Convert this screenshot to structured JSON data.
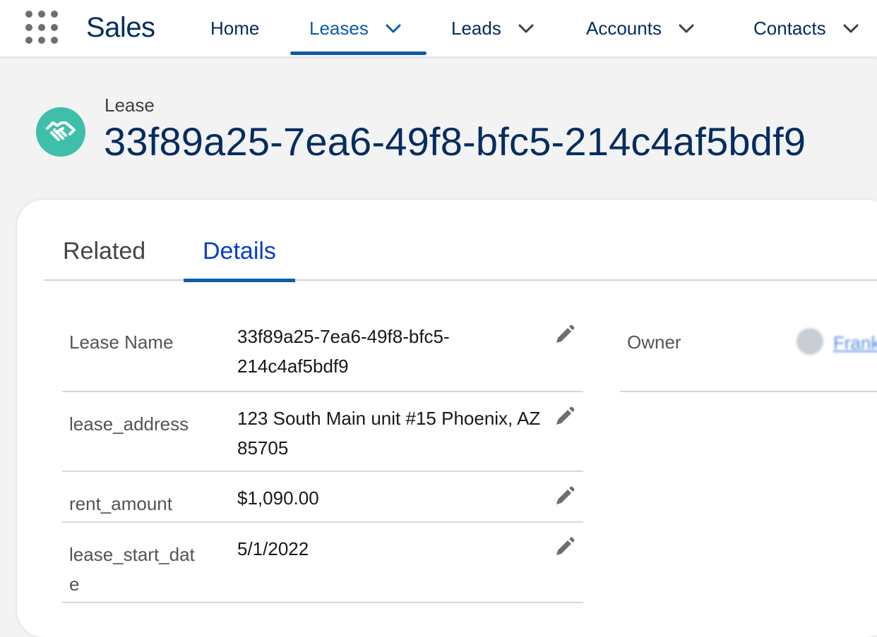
{
  "app": {
    "name": "Sales"
  },
  "nav": {
    "items": [
      {
        "label": "Home",
        "has_menu": false,
        "active": false
      },
      {
        "label": "Leases",
        "has_menu": true,
        "active": true
      },
      {
        "label": "Leads",
        "has_menu": true,
        "active": false
      },
      {
        "label": "Accounts",
        "has_menu": true,
        "active": false
      },
      {
        "label": "Contacts",
        "has_menu": true,
        "active": false
      }
    ]
  },
  "record": {
    "object_label": "Lease",
    "title": "33f89a25-7ea6-49f8-bfc5-214c4af5bdf9",
    "icon": "handshake-icon",
    "icon_color": "#3fbfa9"
  },
  "tabs": [
    {
      "label": "Related",
      "active": false
    },
    {
      "label": "Details",
      "active": true
    }
  ],
  "fields": [
    {
      "label": "Lease Name",
      "value": "33f89a25-7ea6-49f8-bfc5-214c4af5bdf9"
    },
    {
      "label": "lease_address",
      "value": "123 South Main unit #15 Phoenix, AZ 85705"
    },
    {
      "label": "rent_amount",
      "value": "$1,090.00"
    },
    {
      "label": "lease_start_date",
      "value": "5/1/2022"
    }
  ],
  "owner": {
    "label": "Owner",
    "name": "Frank"
  },
  "colors": {
    "brand_navy": "#032d60",
    "active_blue": "#0b5cab",
    "tab_active": "#0b3ec8"
  }
}
